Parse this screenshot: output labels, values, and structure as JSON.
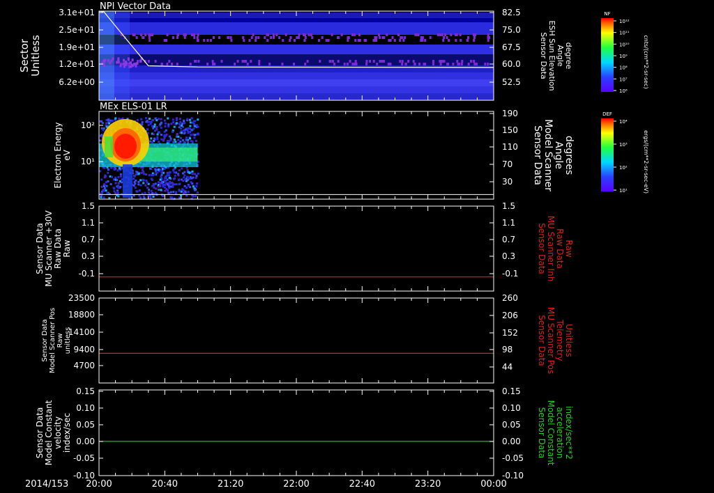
{
  "date_label": "2014/153",
  "time_ticks": [
    "20:00",
    "20:40",
    "21:20",
    "22:00",
    "22:40",
    "23:20",
    "00:00"
  ],
  "colors": {
    "white": "#ffffff",
    "red": "#e0201a",
    "green": "#22d322",
    "background": "#000000"
  },
  "colorbars": [
    {
      "title": "NF",
      "units": "cnts/(cm**2-sr-sec)",
      "ticks": [
        "10¹²",
        "10¹¹",
        "10¹⁰",
        "10⁹",
        "10⁸",
        "10⁷",
        "10⁶"
      ]
    },
    {
      "title": "DEF",
      "units": "ergs/(cm**2-sr-sec-eV)",
      "ticks": [
        "10⁴",
        "10³",
        "10²",
        "10¹"
      ]
    }
  ],
  "chart_data": [
    {
      "type": "heatmap",
      "title": "NPI Vector Data",
      "ylabel_left": [
        "Sector",
        "Unitless"
      ],
      "yticks_left": [
        "3.1e+01",
        "2.5e+01",
        "1.9e+01",
        "1.2e+01",
        "6.2e+00"
      ],
      "ylabel_right": [
        "Sensor Data",
        "ESH Sun Elevation",
        "Angle",
        "degree"
      ],
      "yticks_right": [
        "82.5",
        "75.0",
        "67.5",
        "60.0",
        "52.5"
      ],
      "ylim_right": [
        45,
        82.5
      ],
      "overlay_line": {
        "x_hours": [
          0,
          0.05,
          0.25,
          0.5,
          1.0,
          4.0
        ],
        "y_deg": [
          82.5,
          82.2,
          72.0,
          59.5,
          59.0,
          58.8
        ]
      },
      "color": "#ffffff"
    },
    {
      "type": "heatmap",
      "title": "MEx ELS-01 LR",
      "ylabel_left": [
        "Electron Energy",
        "eV"
      ],
      "yticks_left": [
        "10²",
        "10¹"
      ],
      "ylabel_right": [
        "Sensor Data",
        "Model Scanner",
        "Angle",
        "degrees"
      ],
      "yticks_right": [
        "190",
        "150",
        "110",
        "70",
        "30"
      ],
      "ylim_right": [
        0,
        190
      ],
      "data_extent_hours": [
        0,
        1.0
      ],
      "overlay_line": {
        "y_deg": 10
      },
      "color": "#ffffff"
    },
    {
      "type": "line",
      "ylabel_left": [
        "Sensor Data",
        "MU Scanner +30V",
        "Raw Data",
        "Raw"
      ],
      "yticks_left": [
        "1.5",
        "1.1",
        "0.7",
        "0.3",
        "-0.1"
      ],
      "ylabel_right": [
        "Sensor Data",
        "MU Scanner Inh",
        "Raw Data",
        "Raw"
      ],
      "yticks_right": [
        "1.5",
        "1.1",
        "0.7",
        "0.3",
        "-0.1"
      ],
      "ylim": [
        -0.3,
        1.5
      ],
      "series_value": 0,
      "color": "#e0201a"
    },
    {
      "type": "line",
      "ylabel_left": [
        "Sensor Data",
        "Model Scanner Pos",
        "Raw",
        "unitless"
      ],
      "yticks_left": [
        "23500",
        "18800",
        "14100",
        "9400",
        "4700"
      ],
      "ylabel_right": [
        "Sensor Data",
        "MU Scanner Pos",
        "Telemetry",
        "Unitless"
      ],
      "yticks_right": [
        "260",
        "206",
        "152",
        "98",
        "44"
      ],
      "ylim": [
        0,
        23500
      ],
      "series_value": 8200,
      "color": "#e0201a"
    },
    {
      "type": "line",
      "ylabel_left": [
        "Sensor Data",
        "Model Constant",
        "velocity",
        "index/sec"
      ],
      "yticks_left": [
        "0.15",
        "0.10",
        "0.05",
        "0.00",
        "-0.05",
        "-0.10"
      ],
      "ylabel_right": [
        "Sensor Data",
        "Model Constant",
        "acceleration",
        "index/sec**2"
      ],
      "yticks_right": [
        "0.15",
        "0.10",
        "0.05",
        "0.00",
        "-0.05",
        "-0.10"
      ],
      "ylim": [
        -0.1,
        0.15
      ],
      "series_value": 0,
      "color": "#22d322"
    }
  ]
}
